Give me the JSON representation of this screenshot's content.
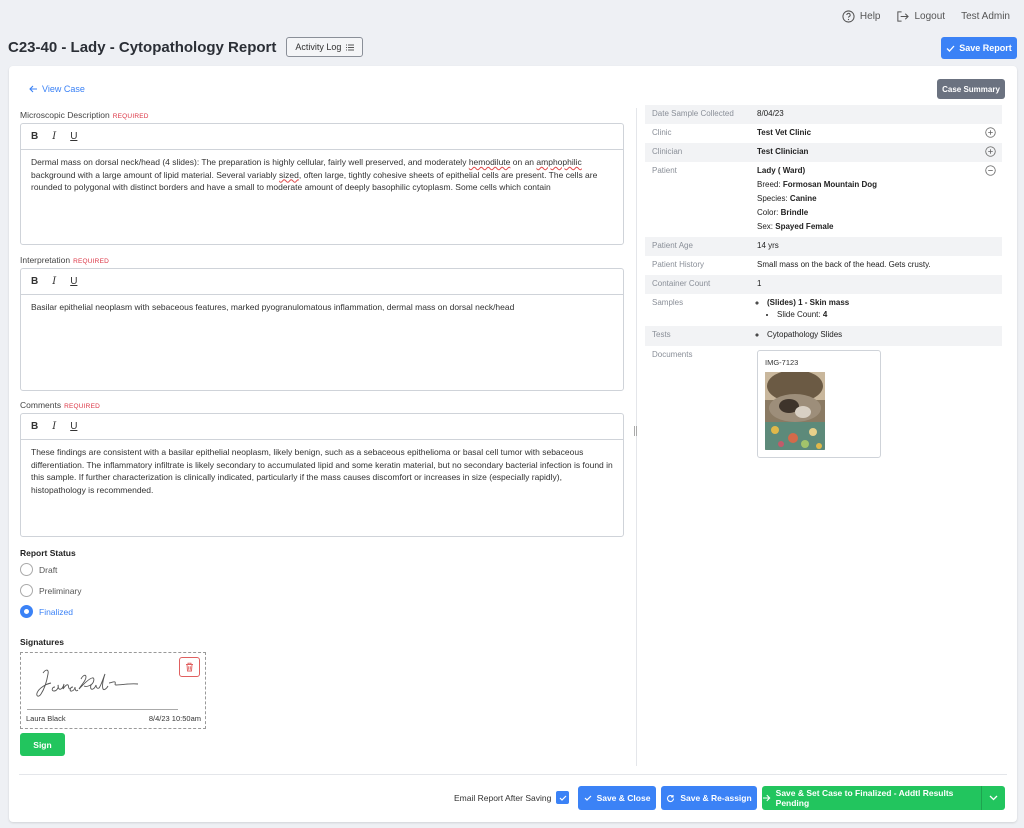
{
  "topnav": {
    "help": "Help",
    "logout": "Logout",
    "user": "Test Admin"
  },
  "header": {
    "title": "C23-40 - Lady - Cytopathology Report",
    "activity_log": "Activity Log",
    "save_report": "Save Report"
  },
  "main": {
    "view_case": "View Case",
    "case_summary": "Case Summary",
    "required_tag": "REQUIRED",
    "microscopic": {
      "label": "Microscopic Description",
      "text_1": "Dermal mass on dorsal neck/head (4 slides): The preparation is highly cellular, fairly well preserved, and moderately ",
      "w1": "hemodilute",
      "text_2": " on an ",
      "w2": "amphophilic",
      "text_3": " background with a large amount of lipid material. Several variably ",
      "w3": "sized",
      "text_4": ", often large, tightly cohesive sheets of epithelial cells are present. The cells are rounded to polygonal with distinct borders and have a small to moderate amount of deeply basophilic cytoplasm. Some cells which contain"
    },
    "interpretation": {
      "label": "Interpretation",
      "text": "Basilar epithelial neoplasm with sebaceous features, marked pyogranulomatous inflammation, dermal mass on dorsal neck/head"
    },
    "comments": {
      "label": "Comments",
      "text": "These findings are consistent with a basilar epithelial neoplasm, likely benign, such as a sebaceous epithelioma or basal cell tumor with sebaceous differentiation. The inflammatory infiltrate is likely secondary to accumulated lipid and some keratin material, but no secondary bacterial infection is found in this sample. If further characterization is clinically indicated, particularly if the mass causes discomfort or increases in size (especially rapidly), histopathology is recommended."
    },
    "toolbar": {
      "bold": "B",
      "italic": "I",
      "underline": "U"
    },
    "report_status": {
      "title": "Report Status",
      "options": [
        "Draft",
        "Preliminary",
        "Finalized"
      ],
      "selected": "Finalized"
    },
    "signatures": {
      "title": "Signatures",
      "name": "Laura Black",
      "date": "8/4/23 10:50am",
      "sign": "Sign"
    }
  },
  "details": {
    "date_collected_label": "Date Sample Collected",
    "date_collected": "8/04/23",
    "clinic_label": "Clinic",
    "clinic": "Test Vet Clinic",
    "clinician_label": "Clinician",
    "clinician": "Test Clinician",
    "patient_label": "Patient",
    "patient": "Lady ( Ward)",
    "breed_label": "Breed:",
    "breed": "Formosan Mountain Dog",
    "species_label": "Species:",
    "species": "Canine",
    "color_label": "Color:",
    "color": "Brindle",
    "sex_label": "Sex:",
    "sex": "Spayed Female",
    "age_label": "Patient Age",
    "age": "14 yrs",
    "history_label": "Patient History",
    "history": "Small mass on the back of the head. Gets crusty.",
    "container_label": "Container Count",
    "container": "1",
    "samples_label": "Samples",
    "sample": "(Slides) 1 - Skin mass",
    "slide_count_label": "Slide Count:",
    "slide_count": "4",
    "tests_label": "Tests",
    "test": "Cytopathology Slides",
    "documents_label": "Documents",
    "document_name": "IMG-7123"
  },
  "footer": {
    "email_label": "Email Report After Saving",
    "save_close": "Save & Close",
    "save_reassign": "Save & Re-assign",
    "save_finalize": "Save & Set Case to Finalized - Addtl Results Pending"
  },
  "colors": {
    "primary": "#3b82f6",
    "success": "#22c55e",
    "secondary": "#6b7280",
    "danger": "#dc3545"
  }
}
